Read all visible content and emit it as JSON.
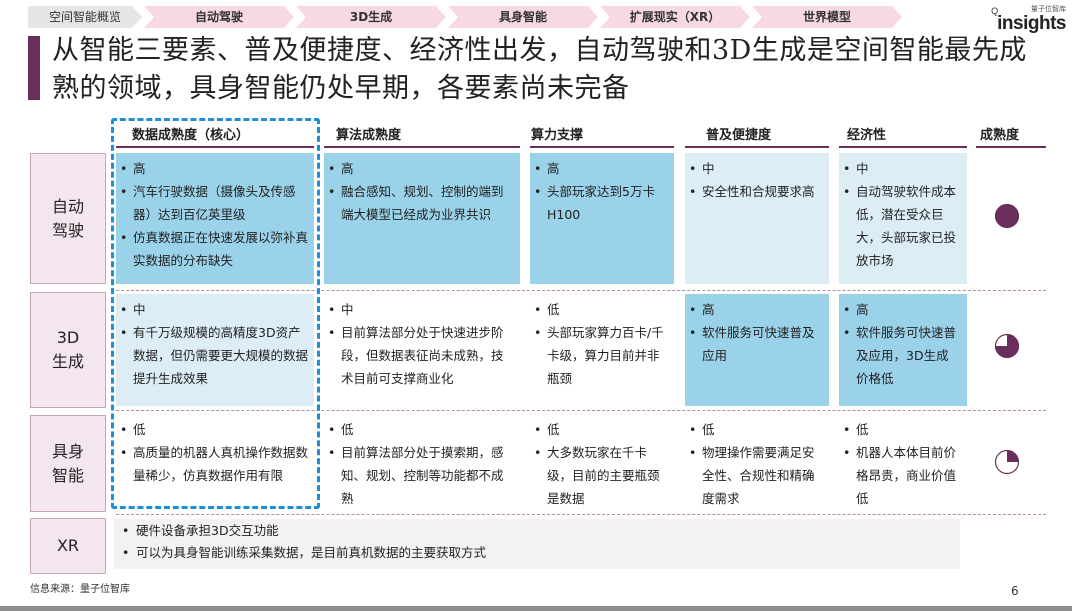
{
  "nav": {
    "items": [
      "空间智能概览",
      "自动驾驶",
      "3D生成",
      "具身智能",
      "扩展现实（XR）",
      "世界模型"
    ]
  },
  "brand": {
    "small": "量子位智库",
    "main": "insights",
    "mark": "Q"
  },
  "title": "从智能三要素、普及便捷度、经济性出发，自动驾驶和3D生成是空间智能最先成熟的领域，具身智能仍处早期，各要素尚未完备",
  "headers": {
    "data": "数据成熟度（核心）",
    "algo": "算法成熟度",
    "compute": "算力支撑",
    "access": "普及便捷度",
    "econ": "经济性",
    "maturity": "成熟度"
  },
  "rows": {
    "auto": {
      "label": "自动\n驾驶",
      "data": [
        "高",
        "汽车行驶数据（摄像头及传感器）达到百亿英里级",
        "仿真数据正在快速发展以弥补真实数据的分布缺失"
      ],
      "algo": [
        "高",
        "融合感知、规划、控制的端到端大模型已经成为业界共识"
      ],
      "compute": [
        "高",
        "头部玩家达到5万卡H100"
      ],
      "access": [
        "中",
        "安全性和合规要求高"
      ],
      "econ": [
        "中",
        "自动驾驶软件成本低，潜在受众巨大，头部玩家已投放市场"
      ],
      "maturity_fraction": 1.0
    },
    "gen3d": {
      "label": "3D\n生成",
      "data": [
        "中",
        "有千万级规模的高精度3D资产数据，但仍需要更大规模的数据提升生成效果"
      ],
      "algo": [
        "中",
        "目前算法部分处于快速进步阶段，但数据表征尚未成熟，技术目前可支撑商业化"
      ],
      "compute": [
        "低",
        "头部玩家算力百卡/千卡级，算力目前并非瓶颈"
      ],
      "access": [
        "高",
        "软件服务可快速普及应用"
      ],
      "econ": [
        "高",
        "软件服务可快速普及应用，3D生成价格低"
      ],
      "maturity_fraction": 0.75
    },
    "embodied": {
      "label": "具身\n智能",
      "data": [
        "低",
        "高质量的机器人真机操作数据数量稀少，仿真数据作用有限"
      ],
      "algo": [
        "低",
        "目前算法部分处于摸索期，感知、规划、控制等功能都不成熟"
      ],
      "compute": [
        "低",
        "大多数玩家在千卡级，目前的主要瓶颈是数据"
      ],
      "access": [
        "低",
        "物理操作需要满足安全性、合规性和精确度需求"
      ],
      "econ": [
        "低",
        "机器人本体目前价格昂贵，商业价值低"
      ],
      "maturity_fraction": 0.25
    },
    "xr": {
      "label": "XR",
      "items": [
        "硬件设备承担3D交互功能",
        "可以为具身智能训练采集数据，是目前真机数据的主要获取方式"
      ]
    }
  },
  "colors": {
    "accent": "#6a2e5a",
    "dark_cell": "#9ad2ea",
    "light_cell": "#dcedf6",
    "highlight_border": "#1d8fd6"
  },
  "footer": {
    "source": "信息来源：量子位智库",
    "page": "6"
  }
}
